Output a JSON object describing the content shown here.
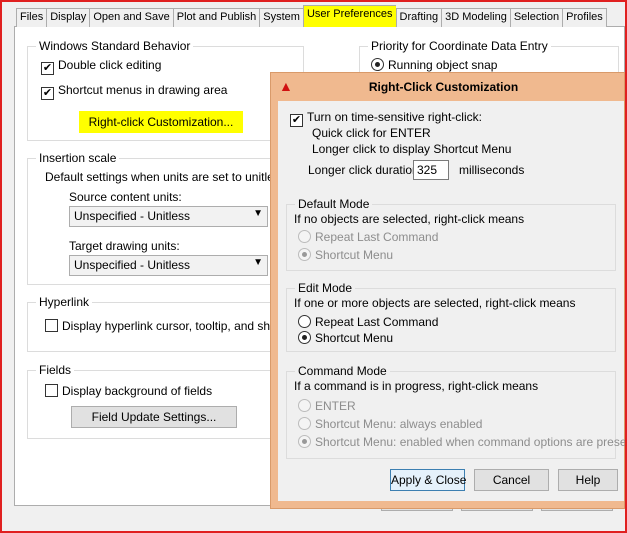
{
  "tabs": [
    "Files",
    "Display",
    "Open and Save",
    "Plot and Publish",
    "System",
    "User Preferences",
    "Drafting",
    "3D Modeling",
    "Selection",
    "Profiles"
  ],
  "active_tab": "User Preferences",
  "windows_behavior": {
    "title": "Windows Standard Behavior",
    "double_click": "Double click editing",
    "shortcut_menus": "Shortcut menus in drawing area",
    "right_click_btn": "Right-click Customization..."
  },
  "insertion": {
    "title": "Insertion scale",
    "desc": "Default settings when units are set to unitless:",
    "source_label": "Source content units:",
    "source_value": "Unspecified - Unitless",
    "target_label": "Target drawing units:",
    "target_value": "Unspecified - Unitless"
  },
  "hyperlink": {
    "title": "Hyperlink",
    "option": "Display hyperlink cursor, tooltip, and shortcut"
  },
  "fields": {
    "title": "Fields",
    "option": "Display background of fields",
    "btn": "Field Update Settings..."
  },
  "priority": {
    "title": "Priority for Coordinate Data Entry",
    "option": "Running object snap"
  },
  "dialog": {
    "title": "Right-Click Customization",
    "time_sensitive": "Turn on time-sensitive right-click:",
    "quick": "Quick click for ENTER",
    "longer": "Longer click to display Shortcut Menu",
    "duration_label": "Longer click duration:",
    "duration_value": "325",
    "duration_unit": "milliseconds",
    "default_mode": {
      "title": "Default Mode",
      "desc": "If no objects are selected, right-click means",
      "opt1": "Repeat Last Command",
      "opt2": "Shortcut Menu"
    },
    "edit_mode": {
      "title": "Edit Mode",
      "desc": "If one or more objects are selected, right-click means",
      "opt1": "Repeat Last Command",
      "opt2": "Shortcut Menu"
    },
    "command_mode": {
      "title": "Command Mode",
      "desc": "If a command is in progress, right-click means",
      "opt1": "ENTER",
      "opt2": "Shortcut Menu: always enabled",
      "opt3": "Shortcut Menu: enabled when command options are present"
    },
    "apply": "Apply & Close",
    "cancel": "Cancel",
    "help": "Help"
  },
  "colors": {
    "highlight": "#ffff00",
    "dialog_border": "#f0b98f",
    "frame": "#e02020"
  }
}
